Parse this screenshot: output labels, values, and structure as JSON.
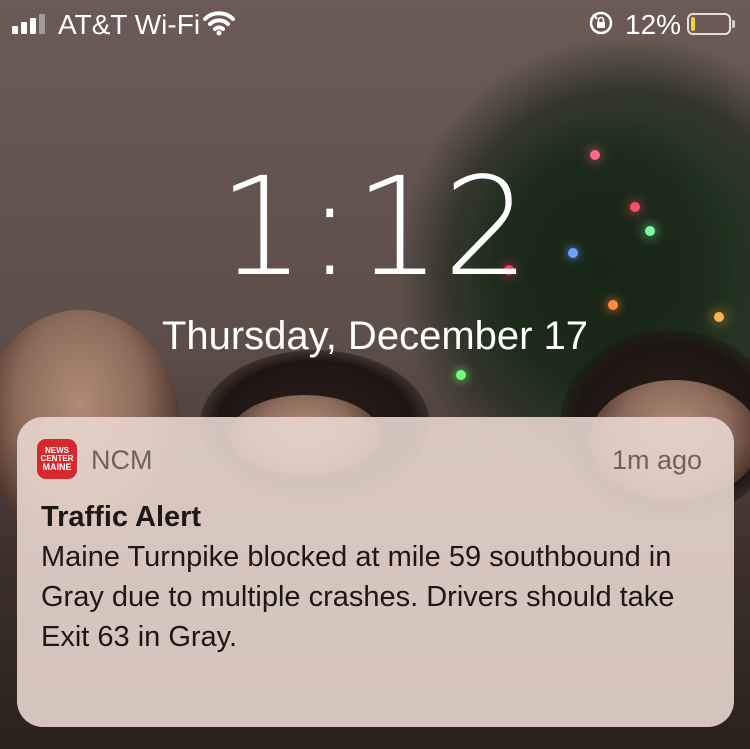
{
  "status_bar": {
    "carrier": "AT&T Wi-Fi",
    "battery_percent": "12%",
    "battery_level": 0.12,
    "signal_bars": 3,
    "icons": [
      "signal-icon",
      "wifi-icon",
      "rotation-lock-icon",
      "battery-icon"
    ]
  },
  "lock_screen": {
    "time": "1:12",
    "date": "Thursday, December 17"
  },
  "notification": {
    "app_icon_text": [
      "NEWS",
      "CENTER",
      "MAINE"
    ],
    "app_name": "NCM",
    "time_ago": "1m ago",
    "title": "Traffic Alert",
    "body": "Maine Turnpike blocked at mile 59 southbound in Gray due to multiple crashes. Drivers should take Exit 63 in Gray."
  },
  "colors": {
    "app_icon_bg": "#d6292e",
    "battery_fill": "#f2d230"
  }
}
